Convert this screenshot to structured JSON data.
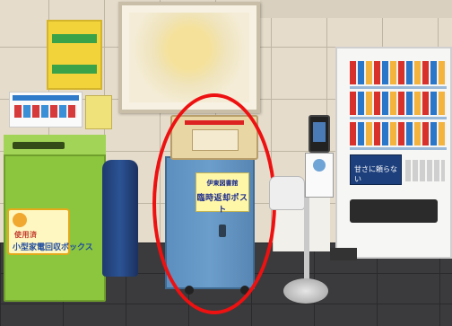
{
  "scene": {
    "highlight_color": "#ee1111",
    "post_color": "#6c9ecb",
    "recycle_box_color": "#8cc63f"
  },
  "book_post_sign": {
    "line1": "伊東図書館",
    "line2": "臨時返却ポスト"
  },
  "recycle_box_label": {
    "line1": "使用済",
    "line2": "小型家電回収ボックス"
  },
  "vending_ad": {
    "text": "甘さに頼らない"
  }
}
